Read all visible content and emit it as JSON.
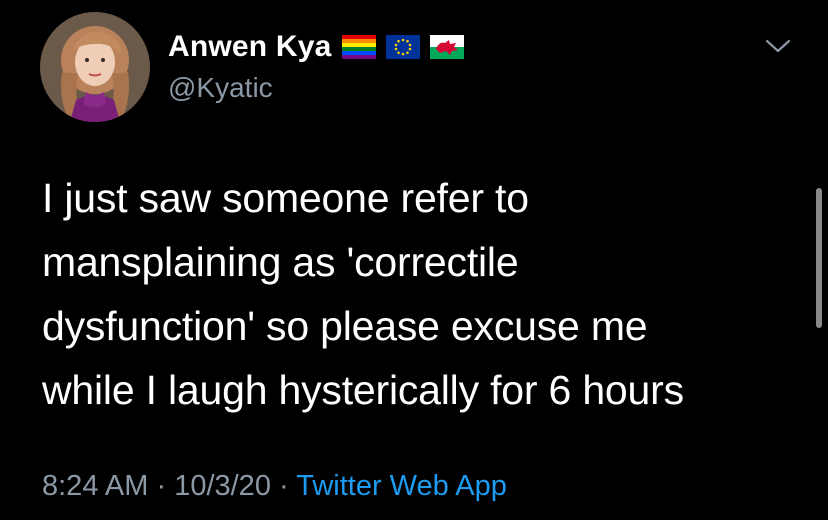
{
  "profile": {
    "display_name": "Anwen Kya",
    "handle": "@Kyatic"
  },
  "flags": [
    "rainbow-flag-icon",
    "eu-flag-icon",
    "wales-flag-icon"
  ],
  "tweet": {
    "lines": [
      "I just saw someone refer to",
      "mansplaining as 'correctile",
      "dysfunction' so please excuse me",
      "while I laugh hysterically for 6 hours"
    ]
  },
  "meta": {
    "time": "8:24 AM",
    "separator_1": " · ",
    "date": "10/3/20",
    "separator_2": " · ",
    "source": "Twitter Web App"
  },
  "colors": {
    "background": "#000000",
    "text": "#ffffff",
    "secondary_text": "#8b98a5",
    "link": "#1d9bf0"
  }
}
